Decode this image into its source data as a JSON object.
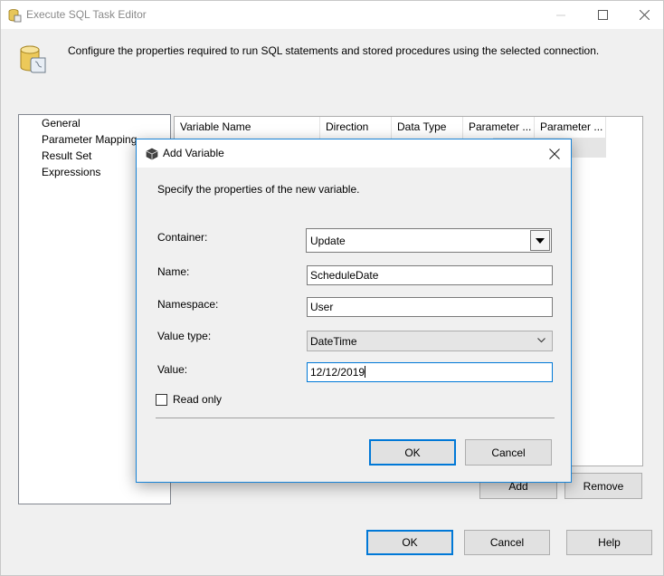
{
  "window": {
    "title": "Execute SQL Task Editor",
    "description": "Configure the properties required to run SQL statements and stored procedures using the selected connection."
  },
  "nav": {
    "items": [
      {
        "label": "General"
      },
      {
        "label": "Parameter Mapping"
      },
      {
        "label": "Result Set"
      },
      {
        "label": "Expressions"
      }
    ]
  },
  "grid": {
    "columns": [
      "Variable Name",
      "Direction",
      "Data Type",
      "Parameter ...",
      "Parameter ..."
    ]
  },
  "pane_buttons": {
    "add": "Add",
    "remove": "Remove"
  },
  "main_buttons": {
    "ok": "OK",
    "cancel": "Cancel",
    "help": "Help"
  },
  "dialog": {
    "title": "Add Variable",
    "instructions": "Specify the properties of the new variable.",
    "fields": {
      "container_label": "Container:",
      "container_value": "Update",
      "name_label": "Name:",
      "name_value": "ScheduleDate",
      "namespace_label": "Namespace:",
      "namespace_value": "User",
      "valuetype_label": "Value type:",
      "valuetype_value": "DateTime",
      "value_label": "Value:",
      "value_value": "12/12/2019"
    },
    "readonly_label": "Read only",
    "readonly_checked": false,
    "ok": "OK",
    "cancel": "Cancel"
  },
  "colors": {
    "accent": "#0078d7",
    "window_bg": "#f0f0f0"
  }
}
